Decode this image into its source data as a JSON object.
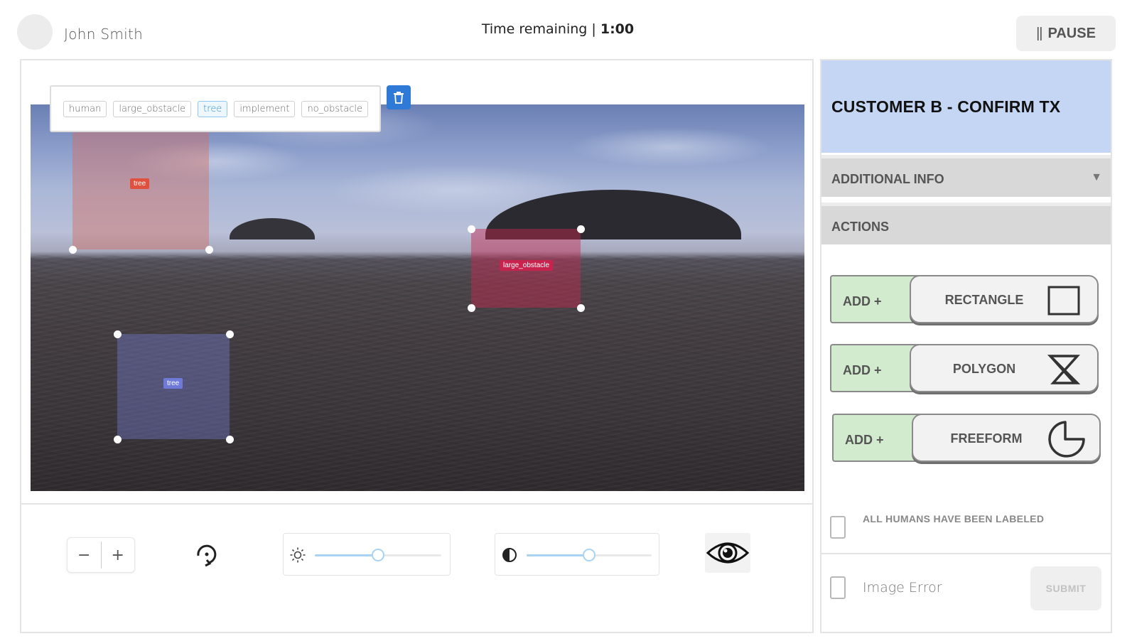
{
  "header": {
    "user_name": "John Smith",
    "timer_label": "Time remaining | ",
    "timer_value": "1:00",
    "pause_label": "PAUSE",
    "pause_icon": "pause-bars-icon"
  },
  "canvas": {
    "label_chips": [
      {
        "label": "human",
        "active": false
      },
      {
        "label": "large_obstacle",
        "active": false
      },
      {
        "label": "tree",
        "active": true
      },
      {
        "label": "implement",
        "active": false
      },
      {
        "label": "no_obstacle",
        "active": false
      }
    ],
    "delete_icon": "trash-icon",
    "annotations": [
      {
        "label": "tree",
        "color": "#e0503f"
      },
      {
        "label": "large_obstacle",
        "color": "#c8234f"
      },
      {
        "label": "tree",
        "color": "#6f7ad8"
      }
    ]
  },
  "toolbar": {
    "zoom_out_label": "−",
    "zoom_in_label": "+",
    "rotate_icon": "rotate-icon",
    "brightness_icon": "sun-icon",
    "brightness_level": 0.5,
    "contrast_icon": "contrast-icon",
    "contrast_level": 0.5,
    "visibility_icon": "eye-icon"
  },
  "right_panel": {
    "title": "CUSTOMER B - CONFIRM TX",
    "additional_info_label": "ADDITIONAL INFO",
    "actions_label": "ACTIONS",
    "add_label": "ADD +",
    "shapes": [
      {
        "label": "RECTANGLE",
        "icon": "rectangle-icon"
      },
      {
        "label": "POLYGON",
        "icon": "hourglass-polygon-icon"
      },
      {
        "label": "FREEFORM",
        "icon": "freeform-icon"
      }
    ],
    "all_humans_label": "ALL HUMANS HAVE BEEN LABELED",
    "image_error_label": "Image Error",
    "submit_label": "SUBMIT"
  },
  "colors": {
    "title_bg": "#c5d6f4",
    "add_bg": "#d2eacd",
    "accent_blue": "#2e7ad6",
    "slider_fill": "#a8d3f3"
  }
}
